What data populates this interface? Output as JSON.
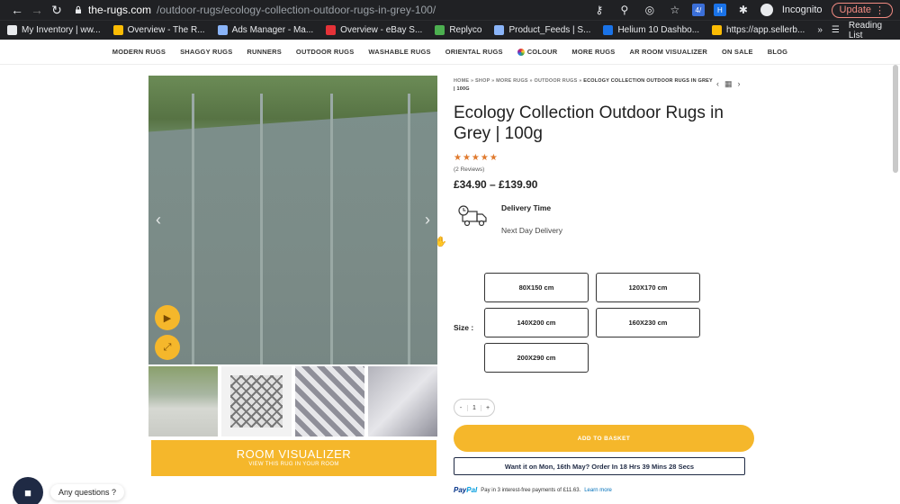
{
  "browser": {
    "url_host": "the-rugs.com",
    "url_path": "/outdoor-rugs/ecology-collection-outdoor-rugs-in-grey-100/",
    "incognito_label": "Incognito",
    "update_label": "Update",
    "bookmarks": [
      {
        "label": "My Inventory | ww...",
        "icon": "refresh-icon",
        "color": "#e8eaed"
      },
      {
        "label": "Overview - The R...",
        "icon": "drive-icon",
        "color": "#fbbc04"
      },
      {
        "label": "Ads Manager - Ma...",
        "icon": "ads-icon",
        "color": "#8ab4f8"
      },
      {
        "label": "Overview - eBay S...",
        "icon": "ebay-icon",
        "color": "#e53238"
      },
      {
        "label": "Replyco",
        "icon": "replyco-icon",
        "color": "#4caf50"
      },
      {
        "label": "Product_Feeds | S...",
        "icon": "feeds-icon",
        "color": "#8ab4f8"
      },
      {
        "label": "Helium 10 Dashbo...",
        "icon": "helium-icon",
        "color": "#1a73e8"
      },
      {
        "label": "https://app.sellerb...",
        "icon": "chart-icon",
        "color": "#fbbc04"
      }
    ],
    "more_label": "»",
    "reading_list_label": "Reading List"
  },
  "nav": {
    "items": [
      "MODERN RUGS",
      "SHAGGY RUGS",
      "RUNNERS",
      "OUTDOOR RUGS",
      "WASHABLE RUGS",
      "ORIENTAL RUGS",
      "COLOUR",
      "MORE RUGS",
      "AR ROOM VISUALIZER",
      "ON SALE",
      "BLOG"
    ]
  },
  "product": {
    "breadcrumb": {
      "home": "HOME",
      "shop": "SHOP",
      "more": "MORE RUGS",
      "cat": "OUTDOOR RUGS",
      "current": "ECOLOGY COLLECTION OUTDOOR RUGS IN GREY | 100G",
      "sep": "»"
    },
    "title": "Ecology Collection Outdoor Rugs in Grey | 100g",
    "rating": 5,
    "stars": "★★★★★",
    "reviews": "(2 Reviews)",
    "price": "£34.90 – £139.90",
    "delivery_title": "Delivery Time",
    "delivery_sub": "Next Day Delivery",
    "size_label": "Size :",
    "sizes": [
      "80X150 cm",
      "120X170 cm",
      "140X200 cm",
      "160X230 cm",
      "200X290 cm"
    ],
    "qty": {
      "minus": "-",
      "value": "1",
      "plus": "+"
    },
    "add_basket": "ADD TO BASKET",
    "want_it": "Want it on Mon, 16th May? Order In 18 Hrs 39 Mins 28 Secs",
    "paypal_text": "Pay in 3 interest-free payments of £11.63.",
    "paypal_link": "Learn more",
    "paypal_logo_a": "Pay",
    "paypal_logo_b": "Pal"
  },
  "gallery": {
    "visualizer_main": "ROOM VISUALIZER",
    "visualizer_sub": "VIEW THIS RUG IN YOUR ROOM",
    "prev": "‹",
    "next": "›"
  },
  "chat": {
    "question": "Any questions ?"
  },
  "colors": {
    "accent": "#f5b72b",
    "navy": "#1f2a44",
    "star": "#e07a2e"
  }
}
